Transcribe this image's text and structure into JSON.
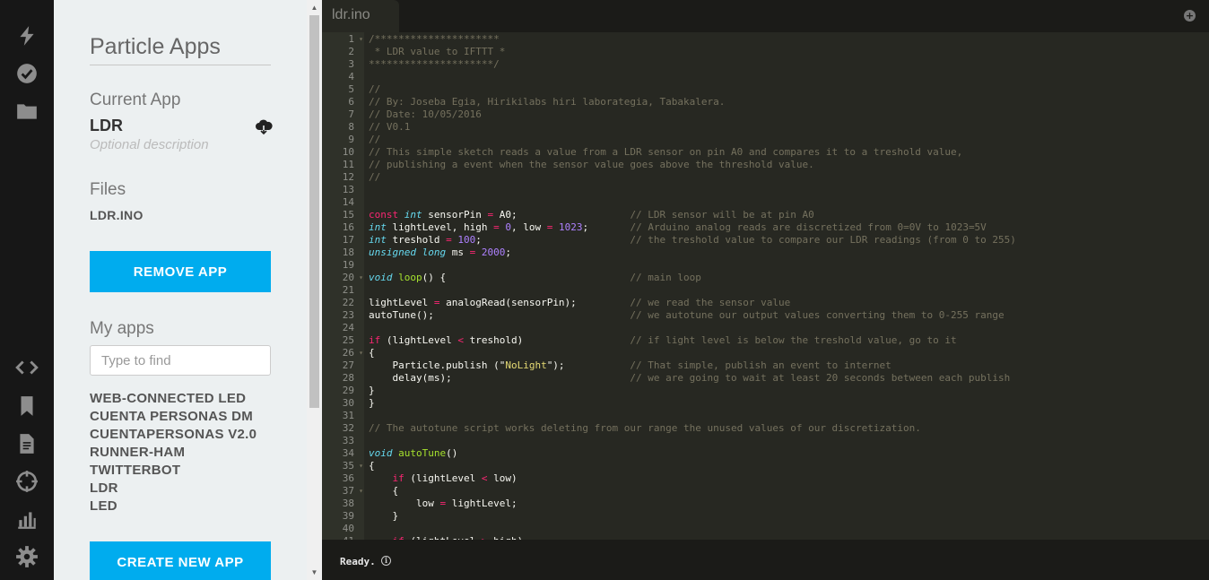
{
  "sidebar_panel": {
    "title": "Particle Apps",
    "current_app_heading": "Current App",
    "current_app_name": "LDR",
    "current_app_description_placeholder": "Optional description",
    "files_heading": "Files",
    "files": [
      "LDR.INO"
    ],
    "remove_button": "REMOVE APP",
    "my_apps_heading": "My apps",
    "search_placeholder": "Type to find",
    "apps": [
      "WEB-CONNECTED LED",
      "CUENTA PERSONAS DM",
      "CUENTAPERSONAS V2.0",
      "RUNNER-HAM",
      "TWITTERBOT",
      "LDR",
      "LED"
    ],
    "create_button": "CREATE NEW APP"
  },
  "rail_icons": {
    "top": [
      "flash-icon",
      "verify-icon",
      "files-icon"
    ],
    "bottom": [
      "code-icon",
      "libraries-icon",
      "docs-icon",
      "devices-icon",
      "console-icon",
      "settings-icon"
    ]
  },
  "editor": {
    "tab_label": "ldr.ino",
    "status_text": "Ready.",
    "lines": [
      "/*********************",
      " * LDR value to IFTTT *",
      "*********************/",
      "",
      "//",
      "// By: Joseba Egia, Hirikilabs hiri laborategia, Tabakalera.",
      "// Date: 10/05/2016",
      "// V0.1",
      "//",
      "// This simple sketch reads a value from a LDR sensor on pin A0 and compares it to a treshold value,",
      "// publishing a event when the sensor value goes above the threshold value.",
      "//",
      "",
      "",
      "const int sensorPin = A0;                   // LDR sensor will be at pin A0",
      "int lightLevel, high = 0, low = 1023;       // Arduino analog reads are discretized from 0=0V to 1023=5V",
      "int treshold = 100;                         // the treshold value to compare our LDR readings (from 0 to 255)",
      "unsigned long ms = 2000;",
      "",
      "void loop() {                               // main loop",
      "",
      "lightLevel = analogRead(sensorPin);         // we read the sensor value",
      "autoTune();                                 // we autotune our output values converting them to 0-255 range",
      "",
      "if (lightLevel < treshold)                  // if light level is below the treshold value, go to it",
      "{",
      "    Particle.publish (\"NoLight\");           // That simple, publish an event to internet",
      "    delay(ms);                              // we are going to wait at least 20 seconds between each publish",
      "}",
      "}",
      "",
      "// The autotune script works deleting from our range the unused values of our discretization.",
      "",
      "void autoTune()",
      "{",
      "    if (lightLevel < low)",
      "    {",
      "        low = lightLevel;",
      "    }",
      "",
      "    if (lightLevel > high)"
    ]
  }
}
